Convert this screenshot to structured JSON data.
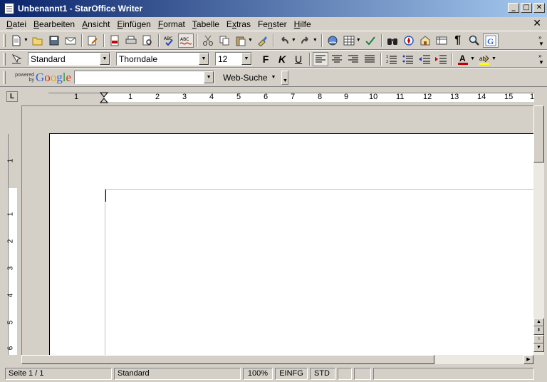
{
  "window": {
    "title": "Unbenannt1 - StarOffice Writer",
    "controls": {
      "minimize": "_",
      "maximize": "□",
      "close": "✕"
    }
  },
  "menu": [
    {
      "label": "Datei",
      "key": "D",
      "rest": "atei"
    },
    {
      "label": "Bearbeiten",
      "key": "B",
      "rest": "earbeiten"
    },
    {
      "label": "Ansicht",
      "key": "A",
      "rest": "nsicht"
    },
    {
      "label": "Einfügen",
      "key": "E",
      "rest": "infügen"
    },
    {
      "label": "Format",
      "key": "F",
      "rest": "ormat"
    },
    {
      "label": "Tabelle",
      "key": "T",
      "rest": "abelle"
    },
    {
      "label": "Extras",
      "key": "x",
      "pre": "E",
      "rest": "tras"
    },
    {
      "label": "Fenster",
      "key": "n",
      "pre": "Fe",
      "rest": "ster"
    },
    {
      "label": "Hilfe",
      "key": "H",
      "rest": "ilfe"
    }
  ],
  "doc_close": "✕",
  "formatting": {
    "paragraph_style": "Standard",
    "font_name": "Thorndale",
    "font_size": "12",
    "bold": "F",
    "italic": "K",
    "underline": "U"
  },
  "google": {
    "powered_line1": "powered",
    "powered_line2": "by",
    "logo": [
      "G",
      "o",
      "o",
      "g",
      "l",
      "e"
    ],
    "search_value": "",
    "web_search_label": "Web-Suche"
  },
  "ruler": {
    "corner": "L",
    "h_numbers": [
      "1",
      "1",
      "2",
      "3",
      "4",
      "5",
      "6",
      "7",
      "8",
      "9",
      "10",
      "11",
      "12",
      "13",
      "14",
      "15",
      "1"
    ],
    "v_numbers": [
      "1",
      "1",
      "2",
      "3",
      "4",
      "5",
      "6"
    ]
  },
  "status": {
    "page": "Seite 1 / 1",
    "style": "Standard",
    "zoom": "100%",
    "insert_mode": "EINFG",
    "selection_mode": "STD"
  },
  "colors": {
    "title_gradient_start": "#0a246a",
    "title_gradient_end": "#a6caf0",
    "font_color": "#c00000",
    "highlight": "#ffff00"
  }
}
